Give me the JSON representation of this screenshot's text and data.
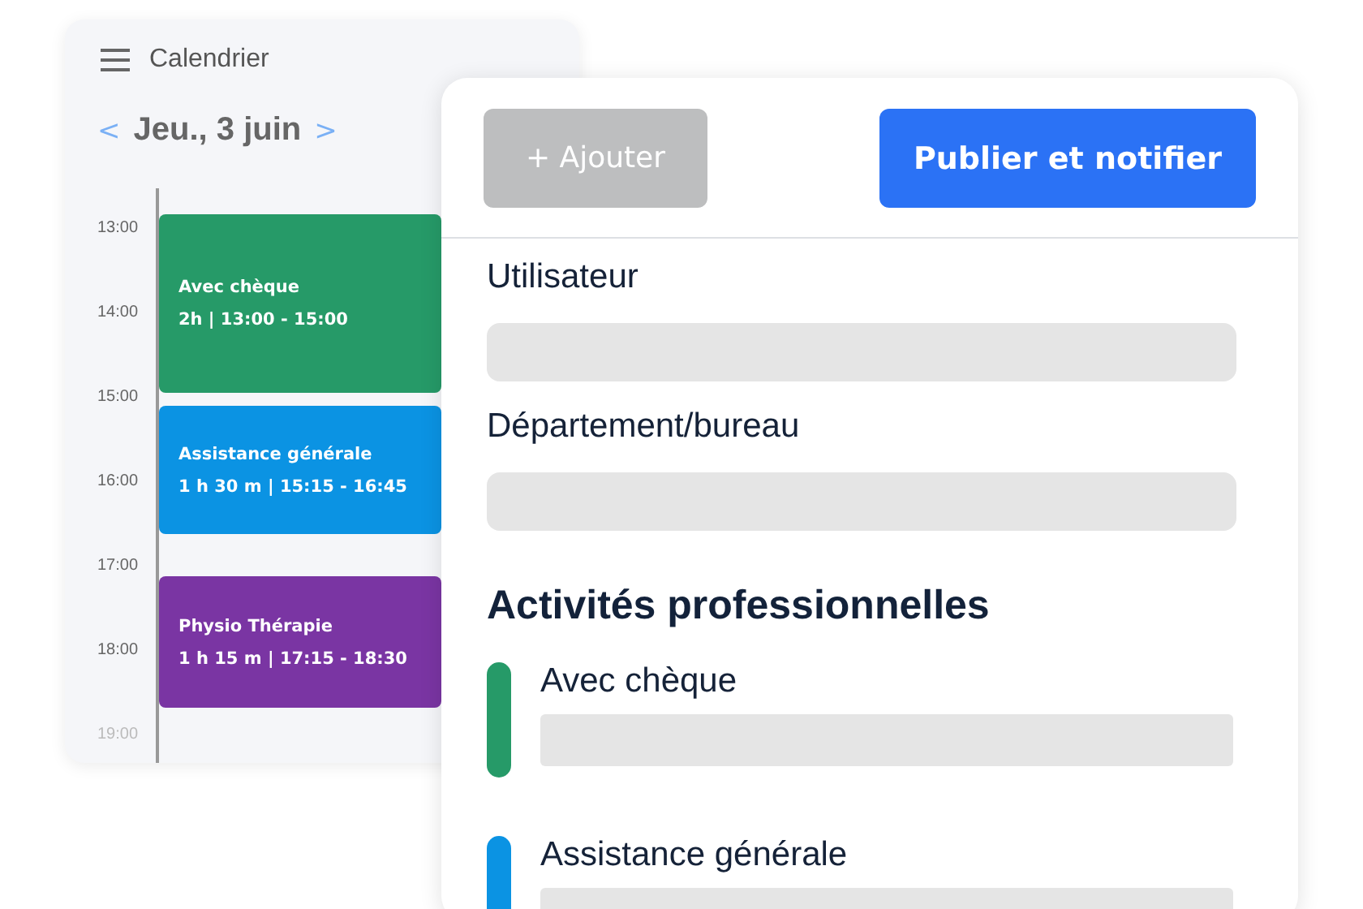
{
  "calendar": {
    "title": "Calendrier",
    "prev": "<",
    "date": "Jeu., 3 juin",
    "next": ">",
    "hours": [
      "13:00",
      "14:00",
      "15:00",
      "16:00",
      "17:00",
      "18:00",
      "19:00"
    ],
    "events": [
      {
        "title": "Avec chèque",
        "time": "2h | 13:00 - 15:00",
        "color": "#269a68"
      },
      {
        "title": "Assistance générale",
        "time": "1 h 30 m | 15:15 - 16:45",
        "color": "#0b93e3"
      },
      {
        "title": "Physio Thérapie",
        "time": "1 h 15 m | 17:15 - 18:30",
        "color": "#7a35a3"
      }
    ]
  },
  "panel": {
    "buttons": [
      {
        "label": "+ Ajouter",
        "disabled": true
      },
      {
        "label": "Publier et notifier",
        "disabled": false
      }
    ],
    "fields": [
      {
        "label": "Utilisateur"
      },
      {
        "label": "Département/bureau"
      }
    ],
    "section_title": "Activités professionnelles",
    "activities": [
      {
        "name": "Avec chèque",
        "color": "#269a68"
      },
      {
        "name": "Assistance générale",
        "color": "#0b93e3"
      }
    ]
  }
}
